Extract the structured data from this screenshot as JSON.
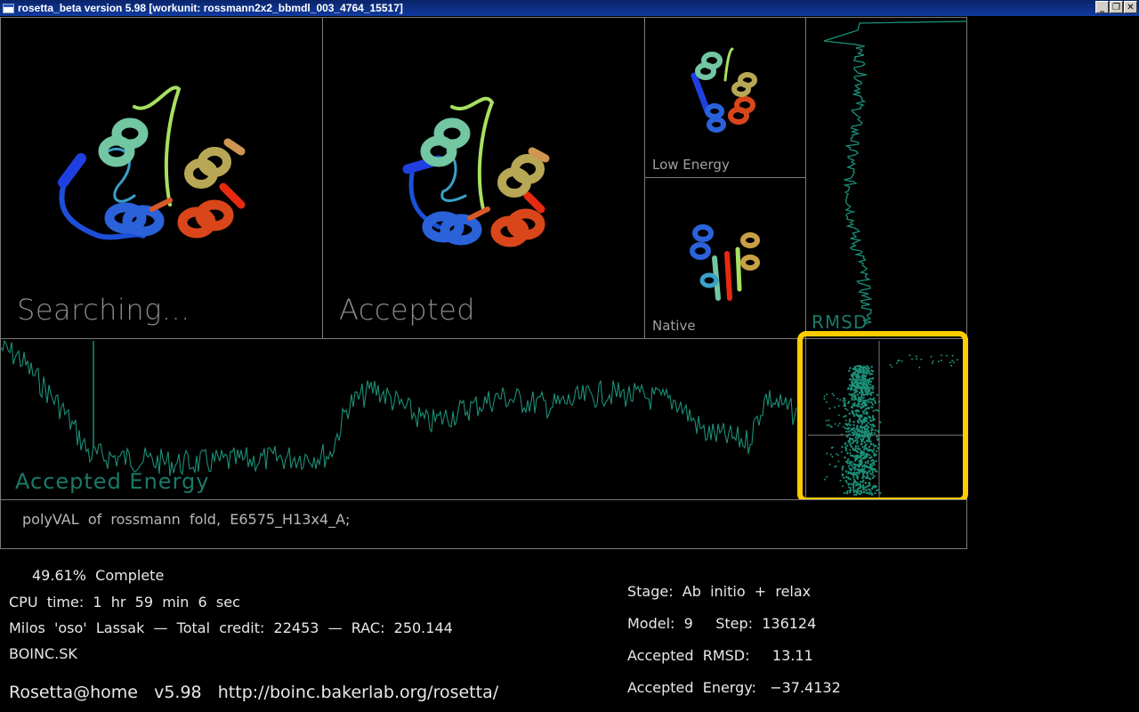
{
  "window": {
    "title": "rosetta_beta version 5.98 [workunit: rossmann2x2_bbmdl_003_4764_15517]"
  },
  "window_buttons": {
    "minimize": "_",
    "restore": "❐",
    "close": "✕"
  },
  "panels": {
    "searching": {
      "label": "Searching..."
    },
    "accepted": {
      "label": "Accepted"
    },
    "low_energy": {
      "label": "Low  Energy"
    },
    "native": {
      "label": "Native"
    },
    "rmsd": {
      "label": "RMSD"
    },
    "accepted_energy": {
      "label": "Accepted  Energy"
    },
    "description": {
      "text": "polyVAL  of  rossmann  fold,  E6575_H13x4_A;"
    }
  },
  "status": {
    "percent_complete": "49.61%  Complete",
    "cpu_time": "CPU  time:  1  hr  59  min  6  sec",
    "user_credit": "Milos  'oso'  Lassak  —  Total  credit:  22453  —  RAC:  250.144",
    "team": "BOINC.SK",
    "footer": "Rosetta@home   v5.98   http://boinc.bakerlab.org/rosetta/"
  },
  "stats": {
    "stage": "Stage:  Ab  initio  +  relax",
    "model_step": "Model:  9     Step:  136124",
    "accepted_rmsd": "Accepted  RMSD:     13.11",
    "accepted_energy": "Accepted  Energy:   −37.4132"
  },
  "colors": {
    "trace": "#1b8f78",
    "highlight": "#ffcc00",
    "border": "#7a7a7a"
  }
}
